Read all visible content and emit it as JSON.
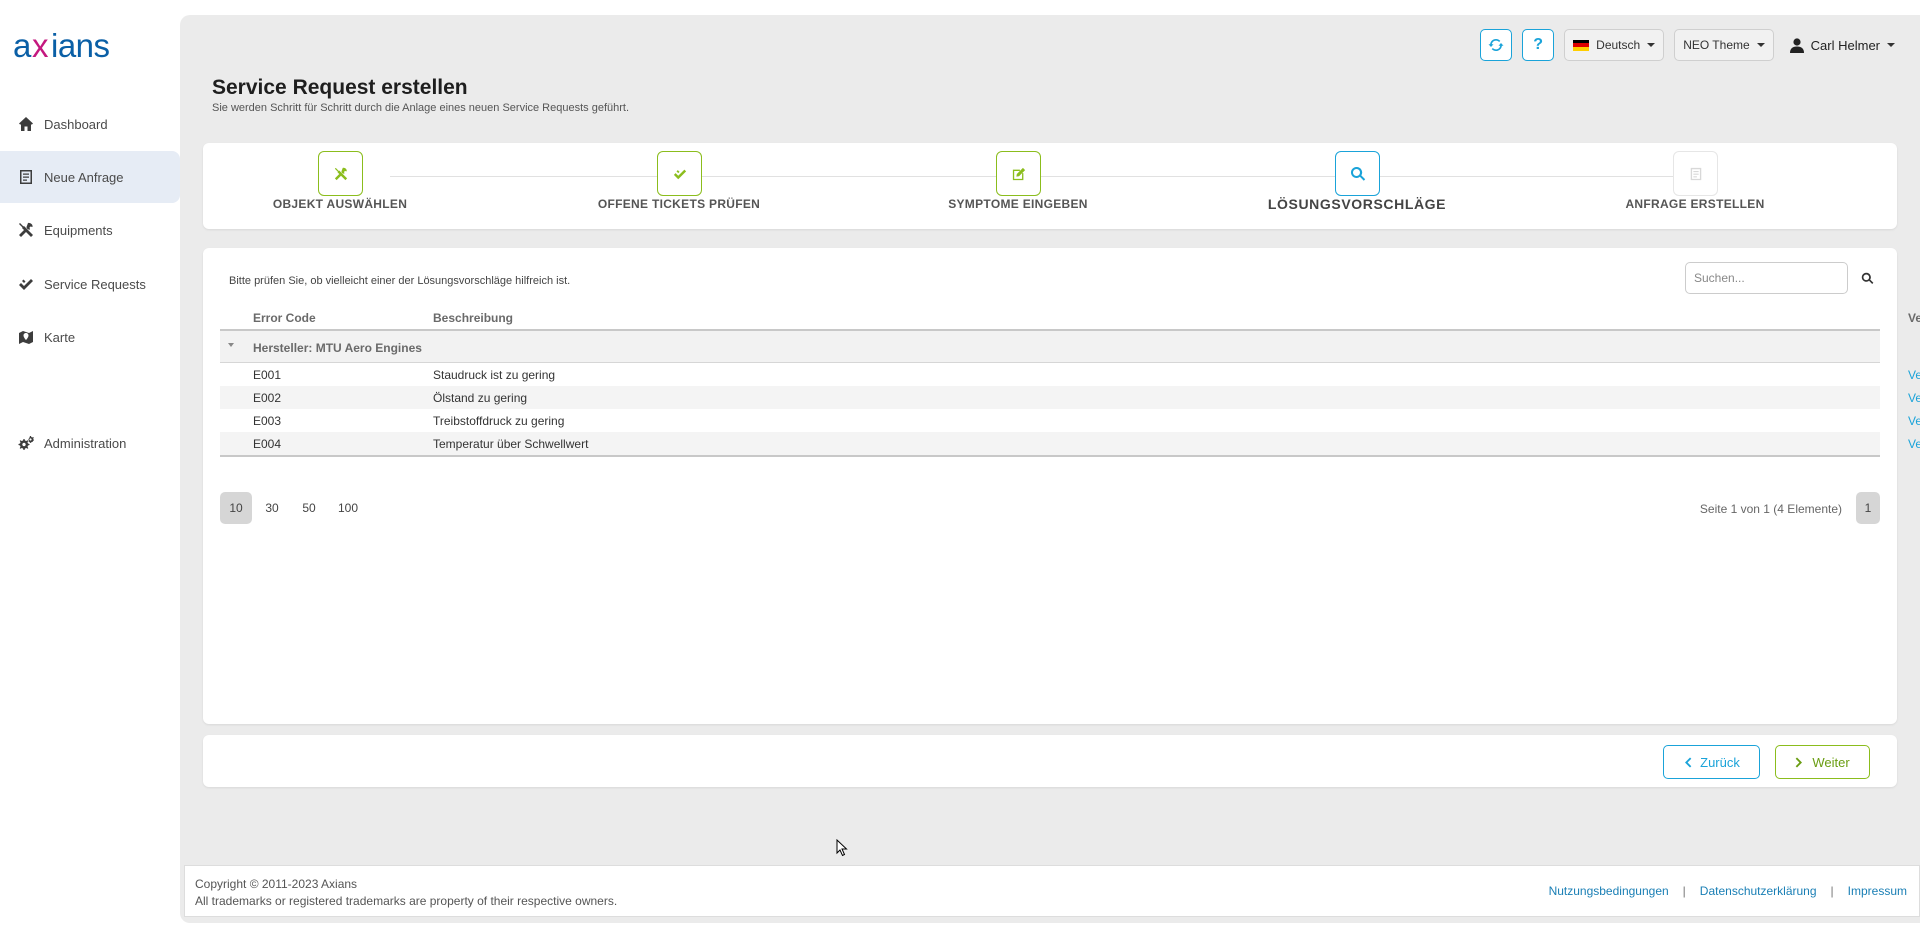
{
  "brand": {
    "logo_text": "axians"
  },
  "sidebar": {
    "items": [
      {
        "label": "Dashboard",
        "icon": "home-icon"
      },
      {
        "label": "Neue Anfrage",
        "icon": "form-icon",
        "active": true
      },
      {
        "label": "Equipments",
        "icon": "tools-icon"
      },
      {
        "label": "Service Requests",
        "icon": "checks-icon"
      },
      {
        "label": "Karte",
        "icon": "map-icon"
      },
      {
        "label": "Administration",
        "icon": "gears-icon"
      }
    ]
  },
  "topbar": {
    "refresh_icon": "refresh-icon",
    "help_icon": "help-icon",
    "language": "Deutsch",
    "theme": "NEO Theme",
    "user": "Carl Helmer"
  },
  "page": {
    "title": "Service Request erstellen",
    "subtitle": "Sie werden Schritt für Schritt durch die Anlage eines neuen Service Requests geführt."
  },
  "steps": [
    {
      "label": "OBJEKT AUSWÄHLEN",
      "state": "done",
      "icon": "tools-icon"
    },
    {
      "label": "OFFENE TICKETS PRÜFEN",
      "state": "done",
      "icon": "check-icon"
    },
    {
      "label": "SYMPTOME EINGEBEN",
      "state": "done",
      "icon": "edit-icon"
    },
    {
      "label": "LÖSUNGSVORSCHLÄGE",
      "state": "current",
      "icon": "search-icon"
    },
    {
      "label": "ANFRAGE ERSTELLEN",
      "state": "future",
      "icon": "form-icon"
    }
  ],
  "panel": {
    "hint": "Bitte prüfen Sie, ob vielleicht einer der Lösungsvorschläge hilfreich ist.",
    "search_placeholder": "Suchen...",
    "columns": [
      "Error Code",
      "Beschreibung",
      "Verknüpfung"
    ],
    "group": "Hersteller: MTU Aero Engines",
    "rows": [
      {
        "code": "E001",
        "description": "Staudruck ist zu gering",
        "link": "Verknüpfung"
      },
      {
        "code": "E002",
        "description": "Ölstand zu gering",
        "link": "Verknüpfung"
      },
      {
        "code": "E003",
        "description": "Treibstoffdruck zu gering",
        "link": "Verknüpfung"
      },
      {
        "code": "E004",
        "description": "Temperatur über Schwellwert",
        "link": "Verknüpfung"
      }
    ],
    "page_sizes": [
      "10",
      "30",
      "50",
      "100"
    ],
    "selected_page_size": "10",
    "page_info": "Seite 1 von 1 (4 Elemente)",
    "current_page": "1"
  },
  "buttons": {
    "back": "Zurück",
    "next": "Weiter"
  },
  "footer": {
    "copyright": "Copyright © 2011-2023 Axians",
    "trademarks": "All trademarks or registered trademarks are property of their respective owners.",
    "links": [
      "Nutzungsbedingungen",
      "Datenschutzerklärung",
      "Impressum"
    ],
    "separator": "|"
  },
  "colors": {
    "accent": "#1aa3d9",
    "success": "#8bbd1d",
    "brand_blue": "#0a5fa6",
    "brand_magenta": "#c4187f"
  }
}
